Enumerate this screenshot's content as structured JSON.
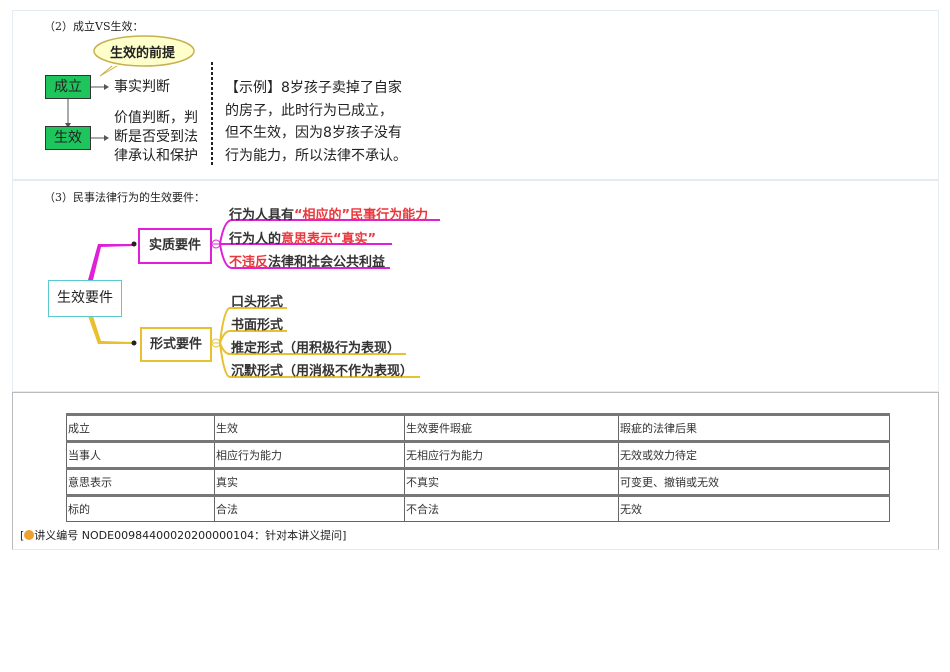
{
  "section2": {
    "caption": "（2）成立VS生效：",
    "bubble": "生效的前提",
    "box1": "成立",
    "box2": "生效",
    "desc1": "事实判断",
    "desc2": [
      "价值判断，判",
      "断是否受到法",
      "律承认和保护"
    ],
    "example": [
      "【示例】8岁孩子卖掉了自家",
      "的房子，此时行为已成立，",
      "但不生效，因为8岁孩子没有",
      "行为能力，所以法律不承认。"
    ]
  },
  "section3": {
    "caption": "（3）民事法律行为的生效要件：",
    "root": "生效要件",
    "substantive": {
      "label": "实质要件",
      "items": [
        {
          "parts": [
            {
              "text": "行为人具有",
              "red": false
            },
            {
              "text": "“相应的”民事行为能力",
              "red": true
            }
          ]
        },
        {
          "parts": [
            {
              "text": "行为人的",
              "red": false
            },
            {
              "text": "意思表示“真实”",
              "red": true
            }
          ]
        },
        {
          "parts": [
            {
              "text": "不违反",
              "red": true
            },
            {
              "text": "法律和社会公共利益",
              "red": false
            }
          ]
        }
      ]
    },
    "formal": {
      "label": "形式要件",
      "items": [
        "口头形式",
        "书面形式",
        "推定形式（用积极行为表现）",
        "沉默形式（用消极不作为表现）"
      ]
    },
    "colors": {
      "magenta": "#e020d8",
      "gold": "#e8c030",
      "root_border": "#5cc8d0"
    }
  },
  "table": {
    "rows": [
      [
        "成立",
        "生效",
        "生效要件瑕疵",
        "瑕疵的法律后果"
      ],
      [
        "当事人",
        "相应行为能力",
        "无相应行为能力",
        "无效或效力待定"
      ],
      [
        "意思表示",
        "真实",
        "不真实",
        "可变更、撤销或无效"
      ],
      [
        "标的",
        "合法",
        "不合法",
        "无效"
      ]
    ]
  },
  "footer": {
    "open": "[",
    "text": "讲义编号 NODE00984400020200000104：针对本讲义提问",
    "close": "]"
  }
}
